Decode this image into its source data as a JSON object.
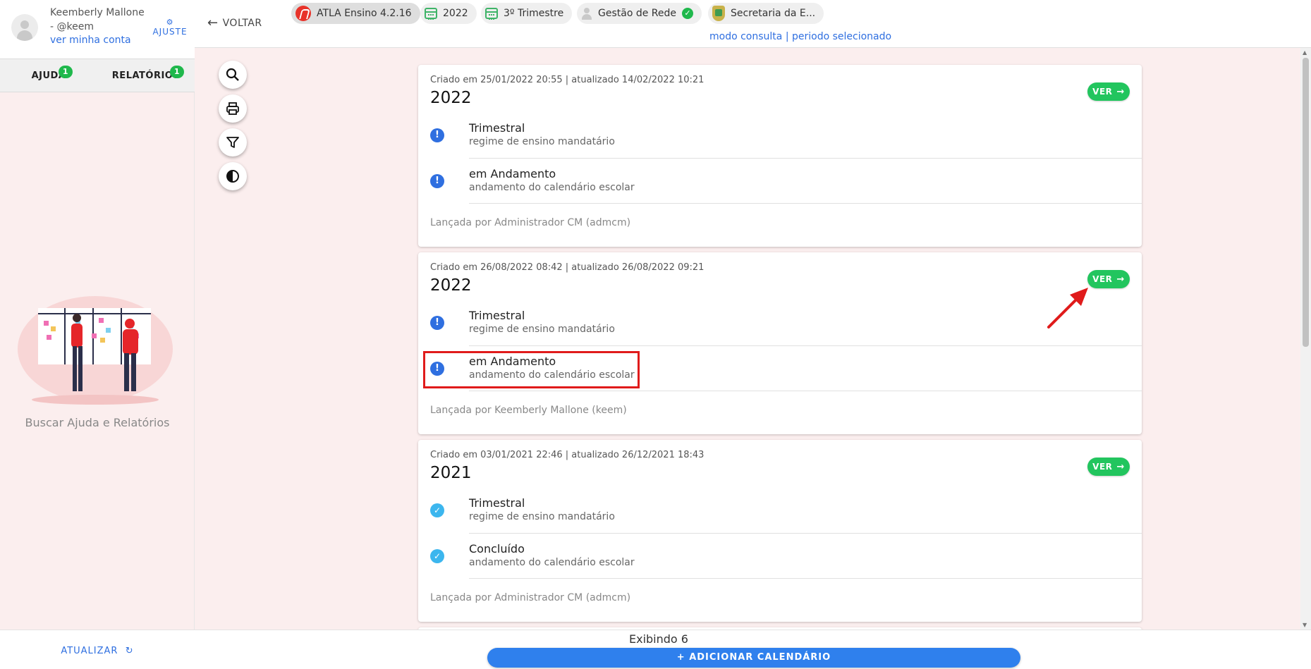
{
  "user": {
    "name_line1": "Keemberly Mallone",
    "name_line2": "- @keem",
    "account_link": "ver minha conta",
    "ajuste_label": "AJUSTE"
  },
  "sidebar": {
    "tabs": [
      {
        "label": "AJUDA",
        "badge": "1"
      },
      {
        "label": "RELATÓRIOS",
        "badge": "1"
      }
    ],
    "help_caption": "Buscar Ajuda e Relatórios",
    "refresh_label": "ATUALIZAR"
  },
  "header": {
    "back_label": "VOLTAR",
    "chips": [
      {
        "label": "ATLA Ensino 4.2.16",
        "icon": "atla-logo-icon"
      },
      {
        "label": "2022",
        "icon": "calendar-icon"
      },
      {
        "label": "3º Trimestre",
        "icon": "calendar-icon"
      },
      {
        "label": "Gestão de Rede",
        "icon": "person-icon",
        "status": "check"
      },
      {
        "label": "Secretaria da E...",
        "icon": "crest-icon"
      }
    ],
    "subheader": "modo consulta | periodo selecionado"
  },
  "colors": {
    "accent": "#2f6fe0",
    "success": "#22c55e",
    "highlight": "#e01b1b",
    "background": "#fbeeee"
  },
  "cards": [
    {
      "meta": "Criado em 25/01/2022 20:55 | atualizado 14/02/2022 10:21",
      "year": "2022",
      "button": "VER",
      "items": [
        {
          "title": "Trimestral",
          "subtitle": "regime de ensino mandatário",
          "status": "info"
        },
        {
          "title": "em Andamento",
          "subtitle": "andamento do calendário escolar",
          "status": "info"
        }
      ],
      "launched": "Lançada por Administrador CM (admcm)"
    },
    {
      "meta": "Criado em 26/08/2022 08:42 | atualizado 26/08/2022 09:21",
      "year": "2022",
      "button": "VER",
      "items": [
        {
          "title": "Trimestral",
          "subtitle": "regime de ensino mandatário",
          "status": "info"
        },
        {
          "title": "em Andamento",
          "subtitle": "andamento do calendário escolar",
          "status": "info"
        }
      ],
      "launched": "Lançada por Keemberly Mallone (keem)"
    },
    {
      "meta": "Criado em 03/01/2021 22:46 | atualizado 26/12/2021 18:43",
      "year": "2021",
      "button": "VER",
      "items": [
        {
          "title": "Trimestral",
          "subtitle": "regime de ensino mandatário",
          "status": "done"
        },
        {
          "title": "Concluído",
          "subtitle": "andamento do calendário escolar",
          "status": "done"
        }
      ],
      "launched": "Lançada por Administrador CM (admcm)"
    }
  ],
  "footer": {
    "count_text": "Exibindo 6",
    "add_button": "ADICIONAR CALENDÁRIO"
  }
}
